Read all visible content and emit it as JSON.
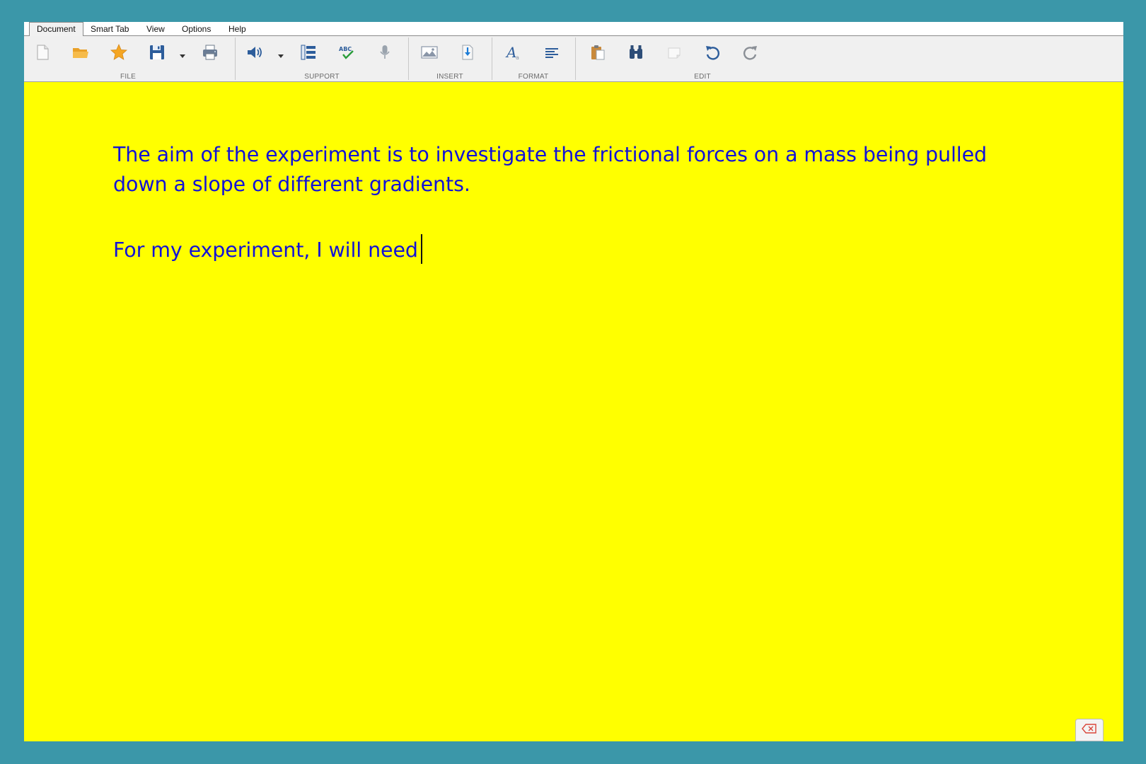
{
  "menubar": {
    "items": [
      {
        "label": "Document"
      },
      {
        "label": "Smart Tab"
      },
      {
        "label": "View"
      },
      {
        "label": "Options"
      },
      {
        "label": "Help"
      }
    ],
    "active": "Document"
  },
  "ribbon": {
    "groups": {
      "file": {
        "label": "FILE",
        "buttons": [
          "new-document-icon",
          "open-folder-icon",
          "favorite-star-icon",
          "save-disk-icon",
          "print-icon"
        ]
      },
      "support": {
        "label": "SUPPORT",
        "buttons": [
          "speaker-icon",
          "numbered-list-icon",
          "spellcheck-icon",
          "microphone-icon"
        ]
      },
      "insert": {
        "label": "INSERT",
        "buttons": [
          "insert-image-icon",
          "insert-file-icon"
        ]
      },
      "format": {
        "label": "FORMAT",
        "buttons": [
          "font-style-icon",
          "align-left-icon"
        ]
      },
      "edit": {
        "label": "EDIT",
        "buttons": [
          "paste-icon",
          "find-binoculars-icon",
          "clear-format-icon",
          "undo-icon",
          "redo-icon"
        ]
      }
    }
  },
  "document": {
    "paragraphs": [
      "The aim of the experiment is to investigate the frictional forces on a mass being pulled down a slope of different gradients.",
      "For my experiment, I will need"
    ],
    "background_color": "#ffff00",
    "text_color": "#1212d8"
  },
  "colors": {
    "desktop": "#3b97a9",
    "ribbon": "#f0f0f0"
  }
}
